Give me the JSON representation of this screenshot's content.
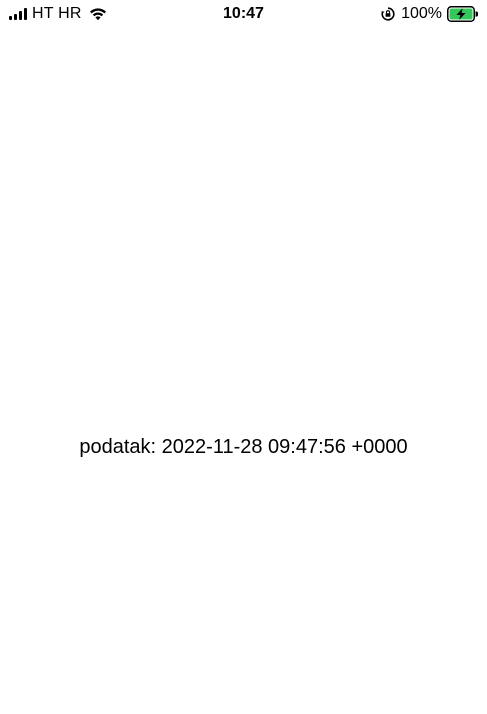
{
  "status_bar": {
    "carrier": "HT HR",
    "time": "10:47",
    "battery_percent": "100%",
    "signal_icon": "cellular-signal-icon",
    "wifi_icon": "wifi-icon",
    "orientation_lock_icon": "orientation-lock-icon",
    "battery_icon": "battery-charging-icon",
    "battery_color": "#34c759"
  },
  "main": {
    "message": "podatak: 2022-11-28 09:47:56 +0000"
  }
}
